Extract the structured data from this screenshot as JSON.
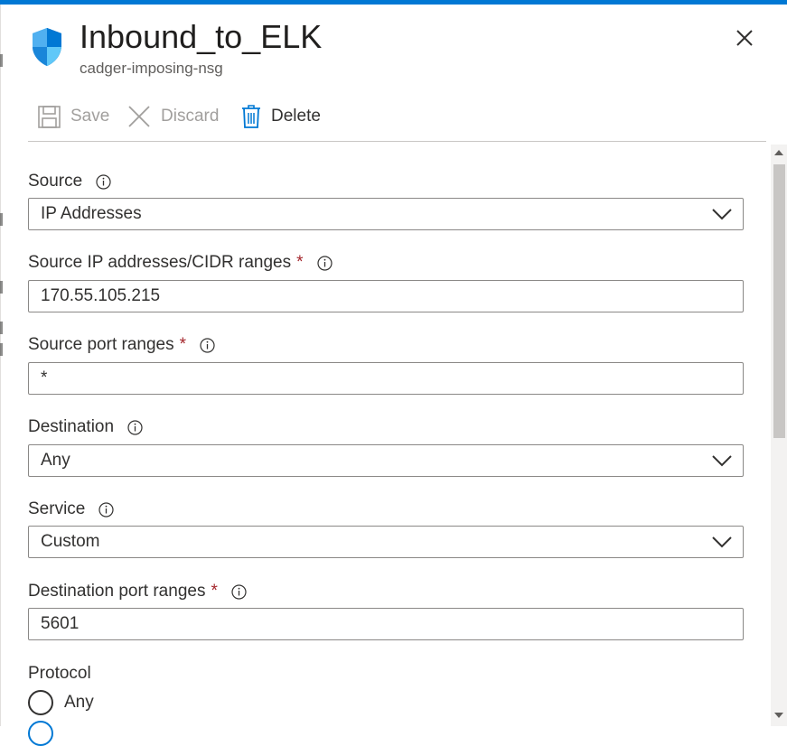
{
  "header": {
    "title": "Inbound_to_ELK",
    "subtitle": "cadger-imposing-nsg",
    "icon": "nsg-shield-icon",
    "accent_color": "#0078d4"
  },
  "toolbar": {
    "save_label": "Save",
    "discard_label": "Discard",
    "delete_label": "Delete"
  },
  "form": {
    "source": {
      "label": "Source",
      "value": "IP Addresses"
    },
    "source_ip": {
      "label": "Source IP addresses/CIDR ranges",
      "required": "*",
      "value": "170.55.105.215"
    },
    "source_port": {
      "label": "Source port ranges",
      "required": "*",
      "value": "*"
    },
    "destination": {
      "label": "Destination",
      "value": "Any"
    },
    "service": {
      "label": "Service",
      "value": "Custom"
    },
    "destination_port": {
      "label": "Destination port ranges",
      "required": "*",
      "value": "5601"
    },
    "protocol": {
      "label": "Protocol",
      "options": [
        "Any"
      ]
    }
  }
}
